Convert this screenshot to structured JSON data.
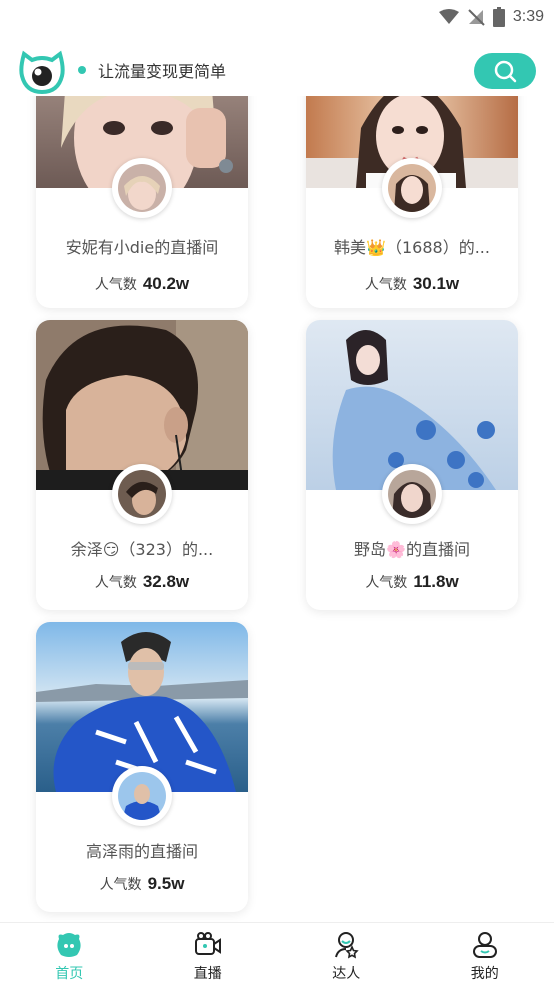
{
  "status_bar": {
    "time": "3:39"
  },
  "header": {
    "slogan": "让流量变现更简单",
    "accent_color": "#33c7b2"
  },
  "cards": [
    {
      "title": "安妮有小die的直播间",
      "popularity_label": "人气数",
      "popularity_value": "40.2w"
    },
    {
      "title": "韩美👑（1688）的...",
      "popularity_label": "人气数",
      "popularity_value": "30.1w"
    },
    {
      "title": "余泽😏（323）的...",
      "popularity_label": "人气数",
      "popularity_value": "32.8w"
    },
    {
      "title": "野岛🌸的直播间",
      "popularity_label": "人气数",
      "popularity_value": "11.8w"
    },
    {
      "title": "高泽雨的直播间",
      "popularity_label": "人气数",
      "popularity_value": "9.5w"
    }
  ],
  "bottom_nav": {
    "items": [
      {
        "label": "首页",
        "icon": "home-icon",
        "active": true
      },
      {
        "label": "直播",
        "icon": "video-camera-icon",
        "active": false
      },
      {
        "label": "达人",
        "icon": "star-person-icon",
        "active": false
      },
      {
        "label": "我的",
        "icon": "profile-icon",
        "active": false
      }
    ]
  }
}
